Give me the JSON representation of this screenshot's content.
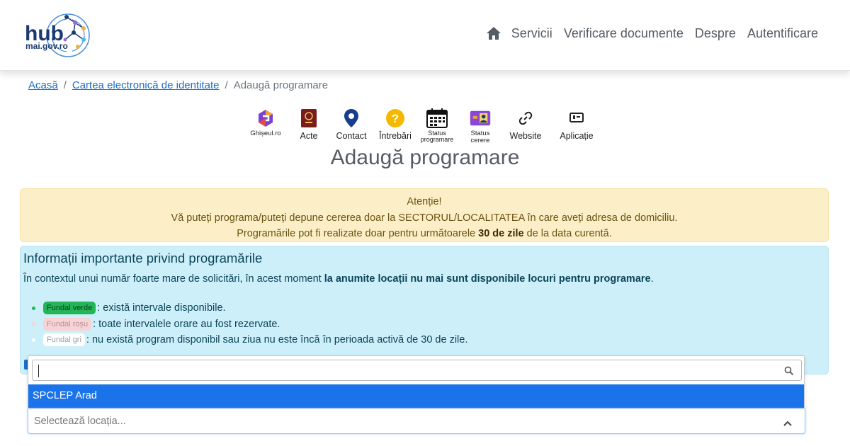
{
  "header": {
    "logo_line1": "hub",
    "logo_line2": "mai.gov.ro",
    "nav": {
      "home_icon": "home-icon",
      "items": [
        "Servicii",
        "Verificare documente",
        "Despre",
        "Autentificare"
      ]
    }
  },
  "breadcrumb": {
    "items": [
      "Acasă",
      "Cartea electronică de identitate",
      "Adaugă programare"
    ],
    "separator": "/"
  },
  "quick_links": [
    {
      "label": "Ghișeul.ro",
      "icon": "ghiseul-logo-icon"
    },
    {
      "label": "Acte",
      "icon": "document-icon"
    },
    {
      "label": "Contact",
      "icon": "location-pin-icon"
    },
    {
      "label": "Întrebări",
      "icon": "question-icon"
    },
    {
      "label": "Status programare",
      "icon": "calendar-icon"
    },
    {
      "label": "Status cerere",
      "icon": "id-card-icon"
    },
    {
      "label": "Website",
      "icon": "link-icon"
    },
    {
      "label": "Aplicație",
      "icon": "app-icon"
    }
  ],
  "page_title": "Adaugă programare",
  "warning": {
    "heading": "Atenție!",
    "line1": "Vă puteți programa/puteți depune cererea doar la SECTORUL/LOCALITATEA în care aveți adresa de domiciliu.",
    "line2_pre": "Programările pot fi realizate doar pentru următoarele ",
    "line2_bold": "30 de zile",
    "line2_post": " de la data curentă."
  },
  "info": {
    "heading": "Informații importante privind programările",
    "para_pre": "În contextul unui număr foarte mare de solicitări, în acest moment ",
    "para_bold": "la anumite locații nu mai sunt disponibile locuri pentru programare",
    "para_post": ".",
    "legend": [
      {
        "pill": "Fundal verde",
        "text": ": există intervale disponibile.",
        "color": "#23b558"
      },
      {
        "pill": "Fundal roșu",
        "text": ": toate intervalele orare au fost rezervate.",
        "color": "#f8d3d5"
      },
      {
        "pill": "Fundal gri",
        "text": ": nu există program disponibil sau ziua nu este încă în perioada activă de 30 de zile.",
        "color": "#ffffff"
      }
    ]
  },
  "location_select": {
    "search_value": "",
    "options": [
      "SPCLEP Arad"
    ],
    "highlighted_option": "SPCLEP Arad",
    "placeholder": "Selectează locația..."
  },
  "colors": {
    "brand_navy": "#1c3a6e",
    "link_blue": "#1a6fc7",
    "option_highlight": "#1a73e8",
    "warning_bg": "#fcefc8",
    "info_bg": "#cdeffa"
  }
}
